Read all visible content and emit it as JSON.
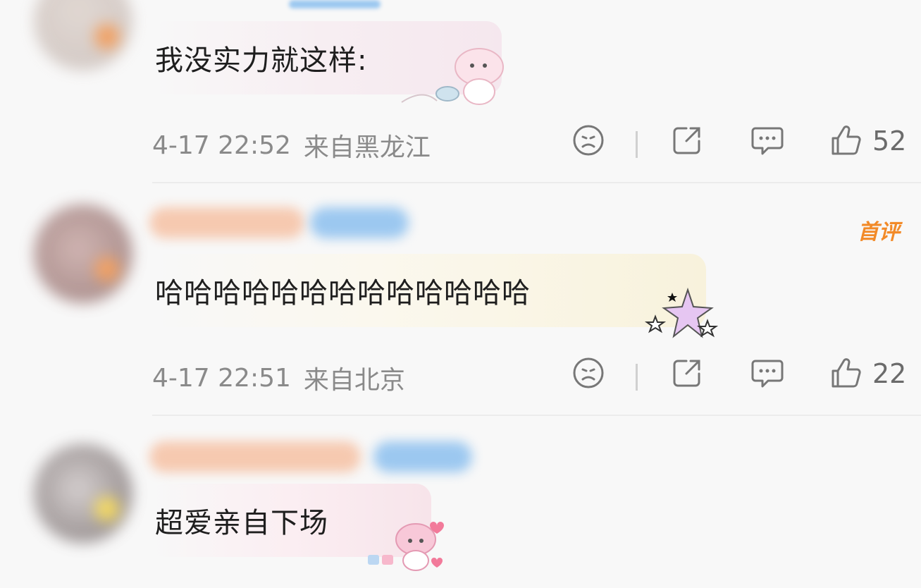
{
  "comments": [
    {
      "text": "我没实力就这样:",
      "time": "4-17 22:52",
      "location": "来自黑龙江",
      "likes": "52",
      "icons": [
        "sad-face-icon",
        "share-icon",
        "comment-icon",
        "like-icon"
      ]
    },
    {
      "text": "哈哈哈哈哈哈哈哈哈哈哈哈哈",
      "time": "4-17 22:51",
      "location": "来自北京",
      "likes": "22",
      "badge": "首评",
      "icons": [
        "sad-face-icon",
        "share-icon",
        "comment-icon",
        "like-icon"
      ]
    },
    {
      "text": "超爱亲自下场"
    }
  ],
  "colors": {
    "accent": "#f28a28",
    "meta": "#8a8a8a",
    "username_blur": "#f6c9b0",
    "vip_blur": "#9cc8f0"
  }
}
